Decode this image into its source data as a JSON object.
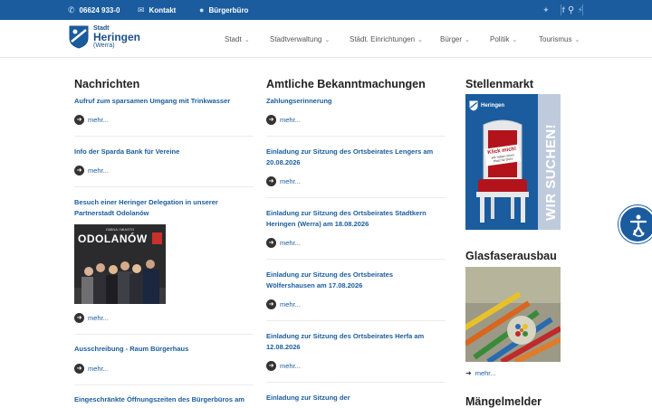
{
  "topbar": {
    "phone": "06624 933-0",
    "contact": "Kontakt",
    "office": "Bürgerbüro"
  },
  "logo": {
    "line1": "Stadt",
    "line2": "Heringen",
    "line3": "(Werra)"
  },
  "nav": [
    "Stadt",
    "Stadtverwaltung",
    "Städt. Einrichtungen",
    "Bürger",
    "Politik",
    "Tourismus"
  ],
  "news": {
    "heading": "Nachrichten",
    "items": [
      "Aufruf zum sparsamen Umgang mit Trinkwasser",
      "Info der Sparda Bank für Vereine",
      "Besuch einer Heringer Delegation in unserer Partnerstadt Odolanów",
      "Ausschreibung - Raum Bürgerhaus",
      "Eingeschränkte Öffnungszeiten des Bürgerbüros am"
    ],
    "image_sign": "ODOLANÓW",
    "image_small": "GMINA I MIASTO"
  },
  "notices": {
    "heading": "Amtliche Bekanntmachungen",
    "items": [
      "Zahlungserinnerung",
      "Einladung zur Sitzung des Ortsbeirates Lengers am 20.08.2026",
      "Einladung zur Sitzung des Ortsbeirates Stadtkern Heringen (Werra) am 18.08.2026",
      "Einladung zur Sitzung des Ortsbeirates Wölfershausen am 17.08.2026",
      "Einladung zur Sitzung des Ortsbeirates Herfa am 12.08.2026",
      "Einladung zur Sitzung der"
    ]
  },
  "sidebar": {
    "jobs_heading": "Stellenmarkt",
    "jobs_banner": "WIR SUCHEN!",
    "jobs_sign": "Klick mich!",
    "jobs_sign_small": "Wir haben einen Platz für Dich!",
    "fiber_heading": "Glasfaserausbau",
    "defects_heading": "Mängelmelder"
  },
  "more_label": "mehr..."
}
